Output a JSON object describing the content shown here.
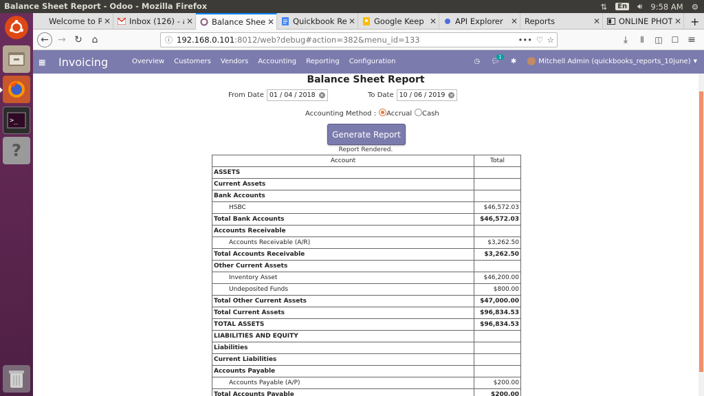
{
  "window": {
    "title": "Balance Sheet Report - Odoo - Mozilla Firefox"
  },
  "panel": {
    "lang": "En",
    "time": "9:58 AM"
  },
  "tabs": [
    {
      "label": "Welcome to P",
      "icon": "welcome-icon"
    },
    {
      "label": "Inbox (126) - a",
      "icon": "gmail-icon"
    },
    {
      "label": "Balance Sheet",
      "icon": "odoo-icon",
      "active": true
    },
    {
      "label": "Quickbook Re",
      "icon": "docs-icon"
    },
    {
      "label": "Google Keep",
      "icon": "keep-icon"
    },
    {
      "label": "API Explorer",
      "icon": "api-icon"
    },
    {
      "label": "Reports",
      "icon": "none"
    },
    {
      "label": "ONLINE PHOT",
      "icon": "photo-icon"
    }
  ],
  "url": {
    "host": "192.168.0.101",
    "rest": ":8012/web?debug#action=382&menu_id=133"
  },
  "odoo": {
    "app": "Invoicing",
    "menu": [
      "Overview",
      "Customers",
      "Vendors",
      "Accounting",
      "Reporting",
      "Configuration"
    ],
    "chat_count": "1",
    "user": "Mitchell Admin (quickbooks_reports_10june)"
  },
  "report": {
    "title": "Balance Sheet Report",
    "from_label": "From Date",
    "from_value": "01 / 04 / 2018",
    "to_label": "To Date",
    "to_value": "10 / 06 / 2019",
    "method_label": "Accounting Method :",
    "accrual": "Accrual",
    "cash": "Cash",
    "button": "Generate Report",
    "status": "Report Rendered.",
    "col_account": "Account",
    "col_total": "Total",
    "rows": [
      {
        "account": "ASSETS",
        "total": "",
        "type": "bold"
      },
      {
        "account": "Current Assets",
        "total": "",
        "type": "bold"
      },
      {
        "account": "Bank Accounts",
        "total": "",
        "type": "bold"
      },
      {
        "account": "HSBC",
        "total": "$46,572.03",
        "type": "indent"
      },
      {
        "account": "Total Bank Accounts",
        "total": "$46,572.03",
        "type": "bold"
      },
      {
        "account": "Accounts Receivable",
        "total": "",
        "type": "bold"
      },
      {
        "account": "Accounts Receivable (A/R)",
        "total": "$3,262.50",
        "type": "indent"
      },
      {
        "account": "Total Accounts Receivable",
        "total": "$3,262.50",
        "type": "bold"
      },
      {
        "account": "Other Current Assets",
        "total": "",
        "type": "bold"
      },
      {
        "account": "Inventory Asset",
        "total": "$46,200.00",
        "type": "indent"
      },
      {
        "account": "Undeposited Funds",
        "total": "$800.00",
        "type": "indent"
      },
      {
        "account": "Total Other Current Assets",
        "total": "$47,000.00",
        "type": "bold"
      },
      {
        "account": "Total Current Assets",
        "total": "$96,834.53",
        "type": "bold"
      },
      {
        "account": "TOTAL ASSETS",
        "total": "$96,834.53",
        "type": "bold"
      },
      {
        "account": "LIABILITIES AND EQUITY",
        "total": "",
        "type": "bold"
      },
      {
        "account": "Liabilities",
        "total": "",
        "type": "bold"
      },
      {
        "account": "Current Liabilities",
        "total": "",
        "type": "bold"
      },
      {
        "account": "Accounts Payable",
        "total": "",
        "type": "bold"
      },
      {
        "account": "Accounts Payable (A/P)",
        "total": "$200.00",
        "type": "indent"
      },
      {
        "account": "Total Accounts Payable",
        "total": "$200.00",
        "type": "bold"
      }
    ]
  },
  "colors": {
    "odoo_primary": "#7c7bad",
    "accent": "#e07a3a",
    "panel": "#3c3b37"
  }
}
